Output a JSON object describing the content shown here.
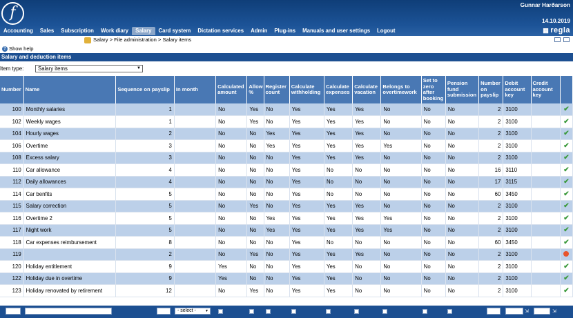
{
  "app": {
    "user": "Gunnar Harðarson",
    "date": "14.10.2019",
    "brand": "regla",
    "logo_letter": "f"
  },
  "menu": [
    "Accounting",
    "Sales",
    "Subscription",
    "Work diary",
    "Salary",
    "Card system",
    "Dictation services",
    "Admin",
    "Plug-ins",
    "Manuals and user settings",
    "Logout"
  ],
  "breadcrumb": "Salary > File administration > Salary items",
  "help_label": "Show help",
  "section_title": "Salary and deduction items",
  "filter": {
    "label": "Item type:",
    "value": "Salary items"
  },
  "columns": [
    "Number",
    "Name",
    "Sequence on payslip",
    "In month",
    "Calculated amount",
    "Allow %",
    "Register count",
    "Calculate withholding",
    "Calculate expenses",
    "Calculate vacation",
    "Belongs to overtimework",
    "Set to zero after booking",
    "Pension fund submission",
    "Number on payslip",
    "Debit account key",
    "Credit account key",
    ""
  ],
  "rows": [
    {
      "number": "100",
      "name": "Monthly salaries",
      "seq": "1",
      "month": "",
      "calc": "No",
      "allow": "Yes",
      "reg": "No",
      "wh": "Yes",
      "exp": "Yes",
      "vac": "Yes",
      "ot": "No",
      "zero": "No",
      "pension": "No",
      "nop": "2",
      "debit": "3100",
      "credit": "",
      "status": "check"
    },
    {
      "number": "102",
      "name": "Weekly wages",
      "seq": "1",
      "month": "",
      "calc": "No",
      "allow": "Yes",
      "reg": "No",
      "wh": "Yes",
      "exp": "Yes",
      "vac": "Yes",
      "ot": "No",
      "zero": "No",
      "pension": "No",
      "nop": "2",
      "debit": "3100",
      "credit": "",
      "status": "check"
    },
    {
      "number": "104",
      "name": "Hourly wages",
      "seq": "2",
      "month": "",
      "calc": "No",
      "allow": "No",
      "reg": "Yes",
      "wh": "Yes",
      "exp": "Yes",
      "vac": "Yes",
      "ot": "No",
      "zero": "No",
      "pension": "No",
      "nop": "2",
      "debit": "3100",
      "credit": "",
      "status": "check"
    },
    {
      "number": "106",
      "name": "Overtime",
      "seq": "3",
      "month": "",
      "calc": "No",
      "allow": "No",
      "reg": "Yes",
      "wh": "Yes",
      "exp": "Yes",
      "vac": "Yes",
      "ot": "Yes",
      "zero": "No",
      "pension": "No",
      "nop": "2",
      "debit": "3100",
      "credit": "",
      "status": "check"
    },
    {
      "number": "108",
      "name": "Excess salary",
      "seq": "3",
      "month": "",
      "calc": "No",
      "allow": "No",
      "reg": "No",
      "wh": "Yes",
      "exp": "Yes",
      "vac": "Yes",
      "ot": "No",
      "zero": "No",
      "pension": "No",
      "nop": "2",
      "debit": "3100",
      "credit": "",
      "status": "check"
    },
    {
      "number": "110",
      "name": "Car allowance",
      "seq": "4",
      "month": "",
      "calc": "No",
      "allow": "No",
      "reg": "No",
      "wh": "Yes",
      "exp": "No",
      "vac": "No",
      "ot": "No",
      "zero": "No",
      "pension": "No",
      "nop": "16",
      "debit": "3110",
      "credit": "",
      "status": "check"
    },
    {
      "number": "112",
      "name": "Daily allowances",
      "seq": "4",
      "month": "",
      "calc": "No",
      "allow": "No",
      "reg": "No",
      "wh": "Yes",
      "exp": "No",
      "vac": "No",
      "ot": "No",
      "zero": "No",
      "pension": "No",
      "nop": "17",
      "debit": "3115",
      "credit": "",
      "status": "check"
    },
    {
      "number": "114",
      "name": "Car benfits",
      "seq": "5",
      "month": "",
      "calc": "No",
      "allow": "No",
      "reg": "No",
      "wh": "Yes",
      "exp": "No",
      "vac": "No",
      "ot": "No",
      "zero": "No",
      "pension": "No",
      "nop": "60",
      "debit": "3450",
      "credit": "",
      "status": "check"
    },
    {
      "number": "115",
      "name": "Salary correction",
      "seq": "5",
      "month": "",
      "calc": "No",
      "allow": "Yes",
      "reg": "No",
      "wh": "Yes",
      "exp": "Yes",
      "vac": "Yes",
      "ot": "No",
      "zero": "No",
      "pension": "No",
      "nop": "2",
      "debit": "3100",
      "credit": "",
      "status": "check"
    },
    {
      "number": "116",
      "name": "Overtime 2",
      "seq": "5",
      "month": "",
      "calc": "No",
      "allow": "No",
      "reg": "Yes",
      "wh": "Yes",
      "exp": "Yes",
      "vac": "Yes",
      "ot": "Yes",
      "zero": "No",
      "pension": "No",
      "nop": "2",
      "debit": "3100",
      "credit": "",
      "status": "check"
    },
    {
      "number": "117",
      "name": "Night work",
      "seq": "5",
      "month": "",
      "calc": "No",
      "allow": "No",
      "reg": "Yes",
      "wh": "Yes",
      "exp": "Yes",
      "vac": "Yes",
      "ot": "Yes",
      "zero": "No",
      "pension": "No",
      "nop": "2",
      "debit": "3100",
      "credit": "",
      "status": "check"
    },
    {
      "number": "118",
      "name": "Car expenses reimbursement",
      "seq": "8",
      "month": "",
      "calc": "No",
      "allow": "No",
      "reg": "No",
      "wh": "Yes",
      "exp": "No",
      "vac": "No",
      "ot": "No",
      "zero": "No",
      "pension": "No",
      "nop": "60",
      "debit": "3450",
      "credit": "",
      "status": "check"
    },
    {
      "number": "119",
      "name": "",
      "seq": "2",
      "month": "",
      "calc": "No",
      "allow": "Yes",
      "reg": "No",
      "wh": "Yes",
      "exp": "Yes",
      "vac": "Yes",
      "ot": "No",
      "zero": "No",
      "pension": "No",
      "nop": "2",
      "debit": "3100",
      "credit": "",
      "status": "dot"
    },
    {
      "number": "120",
      "name": "Holiday entitlement",
      "seq": "9",
      "month": "",
      "calc": "Yes",
      "allow": "No",
      "reg": "No",
      "wh": "Yes",
      "exp": "Yes",
      "vac": "No",
      "ot": "No",
      "zero": "No",
      "pension": "No",
      "nop": "2",
      "debit": "3100",
      "credit": "",
      "status": "check"
    },
    {
      "number": "122",
      "name": "Holiday due in overtime",
      "seq": "9",
      "month": "",
      "calc": "Yes",
      "allow": "No",
      "reg": "No",
      "wh": "Yes",
      "exp": "Yes",
      "vac": "No",
      "ot": "No",
      "zero": "No",
      "pension": "No",
      "nop": "2",
      "debit": "3100",
      "credit": "",
      "status": "check"
    },
    {
      "number": "123",
      "name": "Holiday renovated by retirement",
      "seq": "12",
      "month": "",
      "calc": "No",
      "allow": "Yes",
      "reg": "No",
      "wh": "Yes",
      "exp": "Yes",
      "vac": "No",
      "ot": "No",
      "zero": "No",
      "pension": "No",
      "nop": "2",
      "debit": "3100",
      "credit": "",
      "status": "check"
    }
  ],
  "footer": {
    "month_select": "- select -"
  },
  "colors": {
    "header": "#1c5397",
    "row_alt": "#bcd0e9",
    "th": "#4978b4",
    "check": "#3c9a3c",
    "error": "#e8542c"
  }
}
